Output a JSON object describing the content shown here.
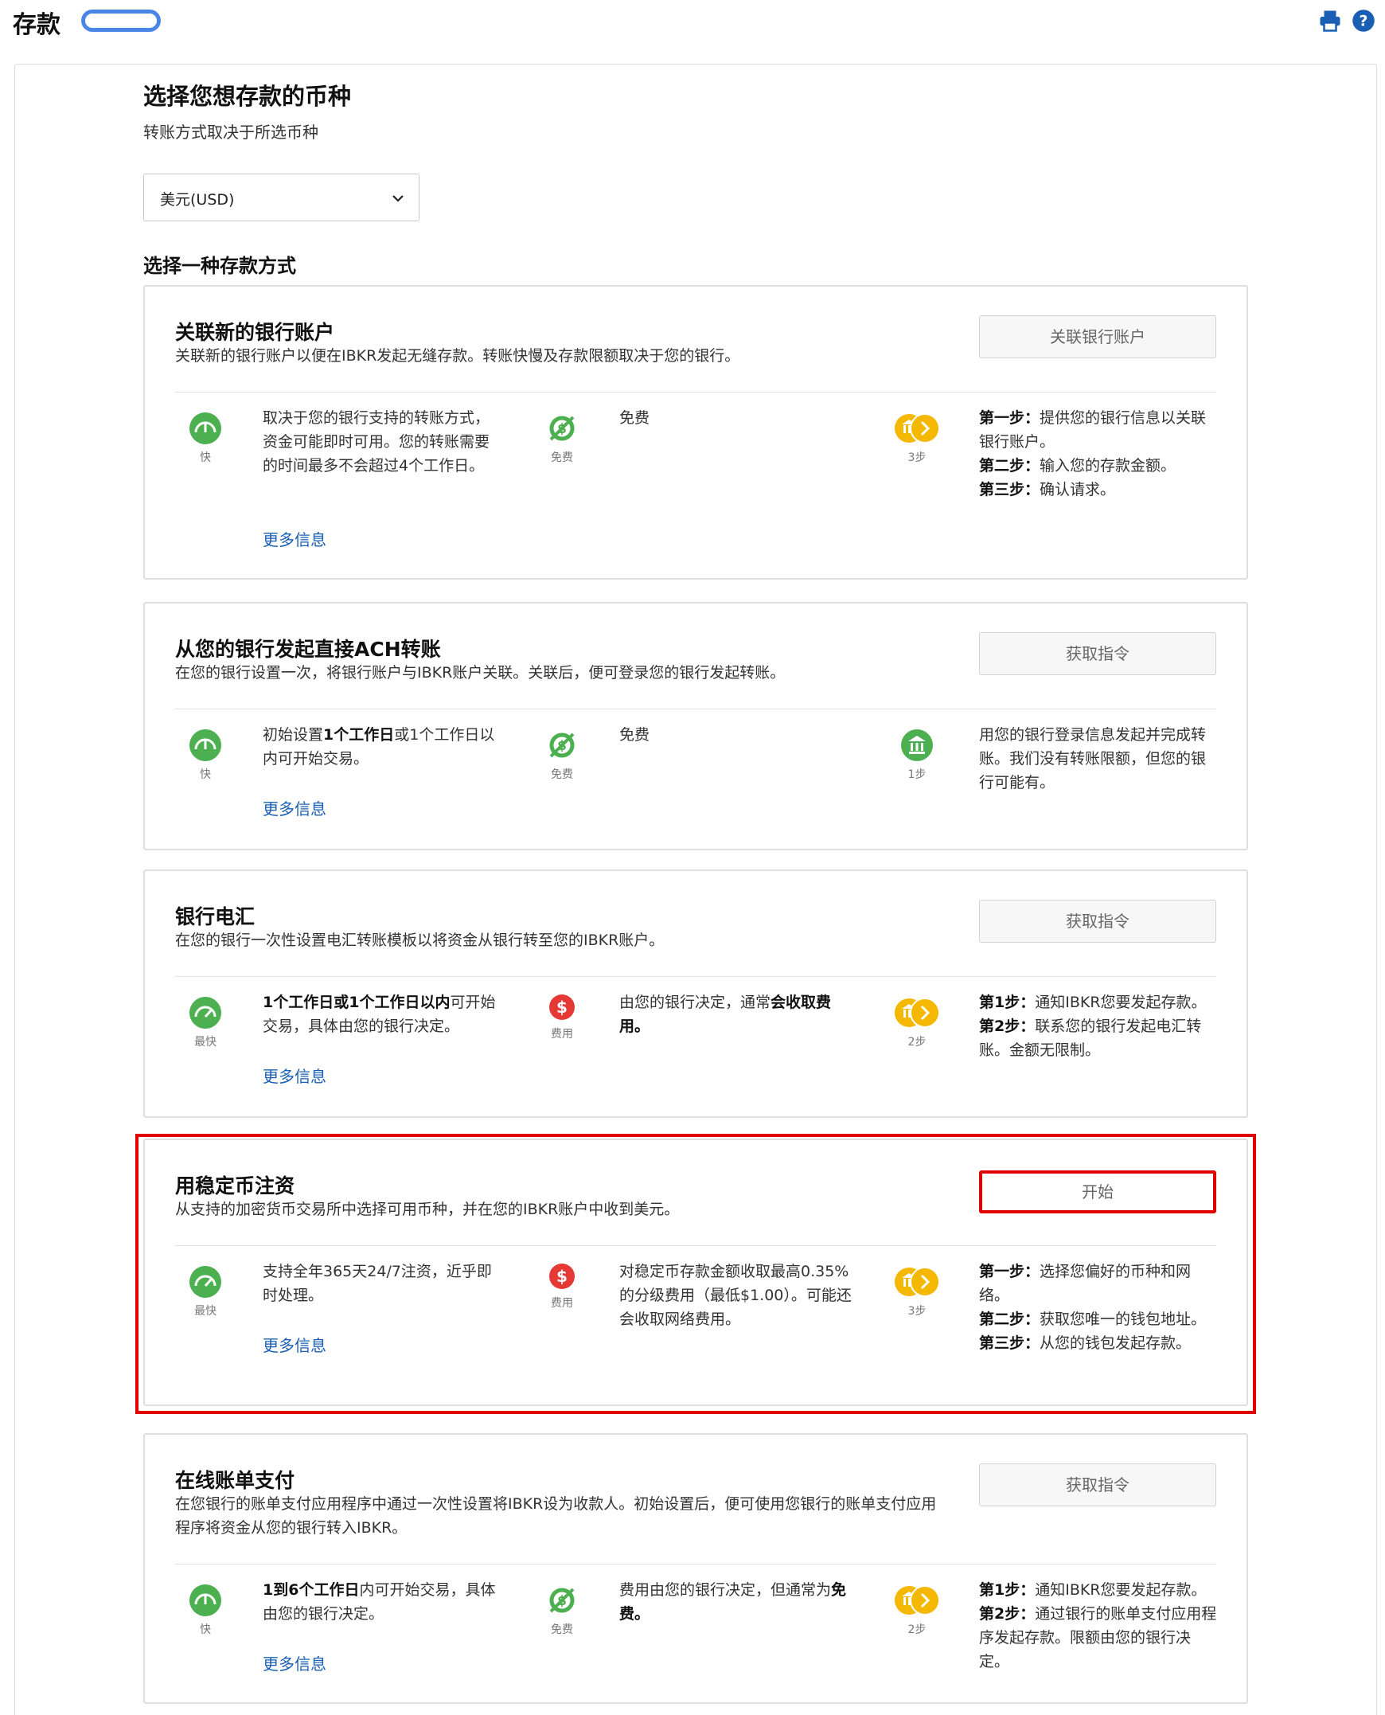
{
  "header": {
    "title": "存款"
  },
  "currency_section": {
    "title": "选择您想存款的币种",
    "subtitle": "转账方式取决于所选币种",
    "selected_currency": "美元(USD)"
  },
  "methods_title": "选择一种存款方式",
  "cards": [
    {
      "title": "关联新的银行账户",
      "desc": "关联新的银行账户以便在IBKR发起无缝存款。转账快慢及存款限额取决于您的银行。",
      "button": "关联银行账户",
      "speed_label": "快",
      "speed_text": "取决于您的银行支持的转账方式，资金可能即时可用。您的转账需要的时间最多不会超过4个工作日。",
      "more": "更多信息",
      "fee_label": "免费",
      "fee_text": "免费",
      "steps_label": "3步",
      "steps": [
        {
          "b": "第一步：",
          "t": "提供您的银行信息以关联银行账户。"
        },
        {
          "b": "第二步：",
          "t": "输入您的存款金额。"
        },
        {
          "b": "第三步：",
          "t": "确认请求。"
        }
      ]
    },
    {
      "title": "从您的银行发起直接ACH转账",
      "desc": "在您的银行设置一次，将银行账户与IBKR账户关联。关联后，便可登录您的银行发起转账。",
      "button": "获取指令",
      "speed_label": "快",
      "speed_b": "1个工作日",
      "speed_a": "初始设置",
      "speed_c": "或1个工作日以内可开始交易。",
      "more": "更多信息",
      "fee_label": "免费",
      "fee_text": "免费",
      "steps_label": "1步",
      "steps_text": "用您的银行登录信息发起并完成转账。我们没有转账限额，但您的银行可能有。"
    },
    {
      "title": "银行电汇",
      "desc": "在您的银行一次性设置电汇转账模板以将资金从银行转至您的IBKR账户。",
      "button": "获取指令",
      "speed_label": "最快",
      "speed_b": "1个工作日或1个工作日以内",
      "speed_c": "可开始交易，具体由您的银行决定。",
      "more": "更多信息",
      "fee_label": "费用",
      "fee_a": "由您的银行决定，通常",
      "fee_b": "会收取费用",
      "fee_c": "。",
      "steps_label": "2步",
      "steps": [
        {
          "b": "第1步：",
          "t": "通知IBKR您要发起存款。"
        },
        {
          "b": "第2步：",
          "t": "联系您的银行发起电汇转账。金额无限制。"
        }
      ]
    },
    {
      "title": "用稳定币注资",
      "desc": "从支持的加密货币交易所中选择可用币种，并在您的IBKR账户中收到美元。",
      "button": "开始",
      "speed_label": "最快",
      "speed_text": "支持全年365天24/7注资，近乎即时处理。",
      "more": "更多信息",
      "fee_label": "费用",
      "fee_text": "对稳定币存款金额收取最高0.35%的分级费用（最低$1.00）。可能还会收取网络费用。",
      "steps_label": "3步",
      "steps": [
        {
          "b": "第一步：",
          "t": "选择您偏好的币种和网络。"
        },
        {
          "b": "第二步：",
          "t": "获取您唯一的钱包地址。"
        },
        {
          "b": "第三步：",
          "t": "从您的钱包发起存款。"
        }
      ]
    },
    {
      "title": "在线账单支付",
      "desc": "在您银行的账单支付应用程序中通过一次性设置将IBKR设为收款人。初始设置后，便可使用您银行的账单支付应用程序将资金从您的银行转入IBKR。",
      "button": "获取指令",
      "speed_label": "快",
      "speed_b": "1到6个工作日",
      "speed_c": "内可开始交易，具体由您的银行决定。",
      "more": "更多信息",
      "fee_label": "免费",
      "fee_a": "费用由您的银行决定，但通常为",
      "fee_b": "免费",
      "fee_c": "。",
      "steps_label": "2步",
      "steps": [
        {
          "b": "第1步：",
          "t": "通知IBKR您要发起存款。"
        },
        {
          "b": "第2步：",
          "t": "通过银行的账单支付应用程序发起存款。限额由您的银行决定。"
        }
      ]
    }
  ],
  "colors": {
    "green": "#4caf50",
    "red": "#e53935",
    "gold": "#f5b800",
    "link": "#1a5fb4",
    "highlight": "#e00000"
  }
}
